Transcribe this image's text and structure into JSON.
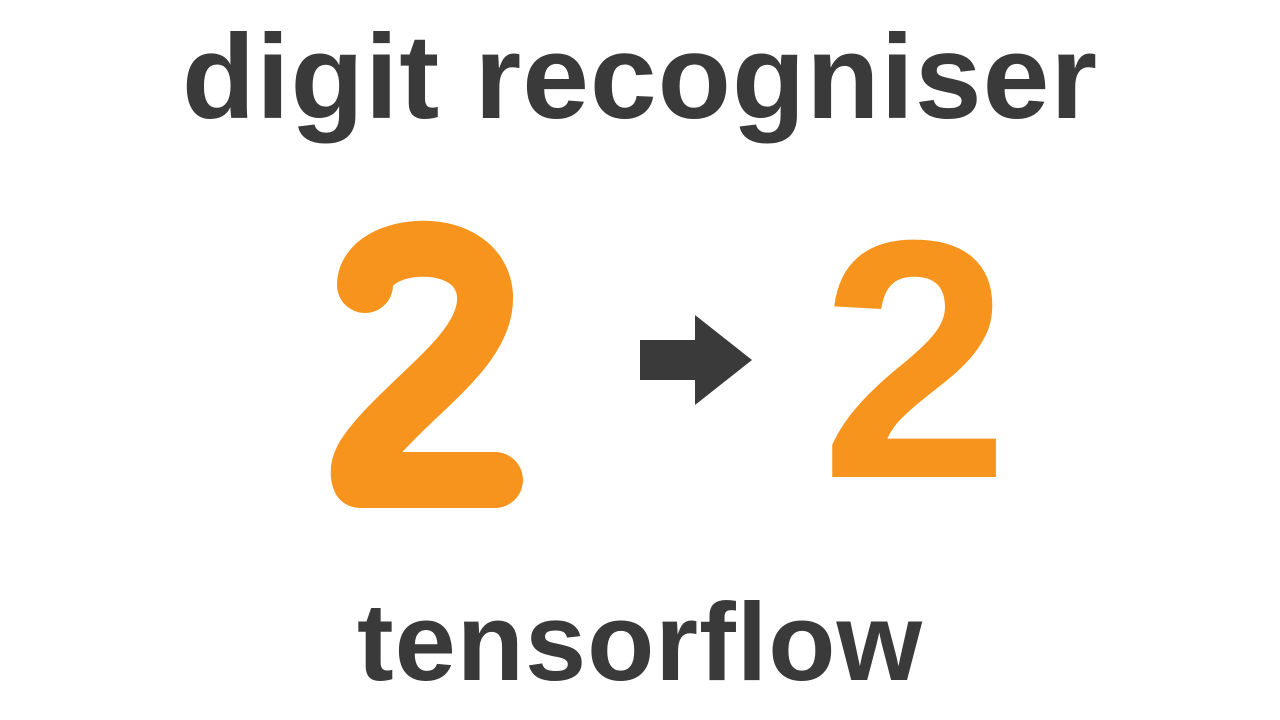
{
  "title": "digit recogniser",
  "subtitle": "tensorflow",
  "input_digit": "2",
  "output_digit": "2",
  "colors": {
    "text": "#3a3a3a",
    "accent": "#f7941e",
    "arrow": "#3a3a3a",
    "background": "#ffffff"
  },
  "icons": {
    "arrow": "arrow-right-icon"
  }
}
